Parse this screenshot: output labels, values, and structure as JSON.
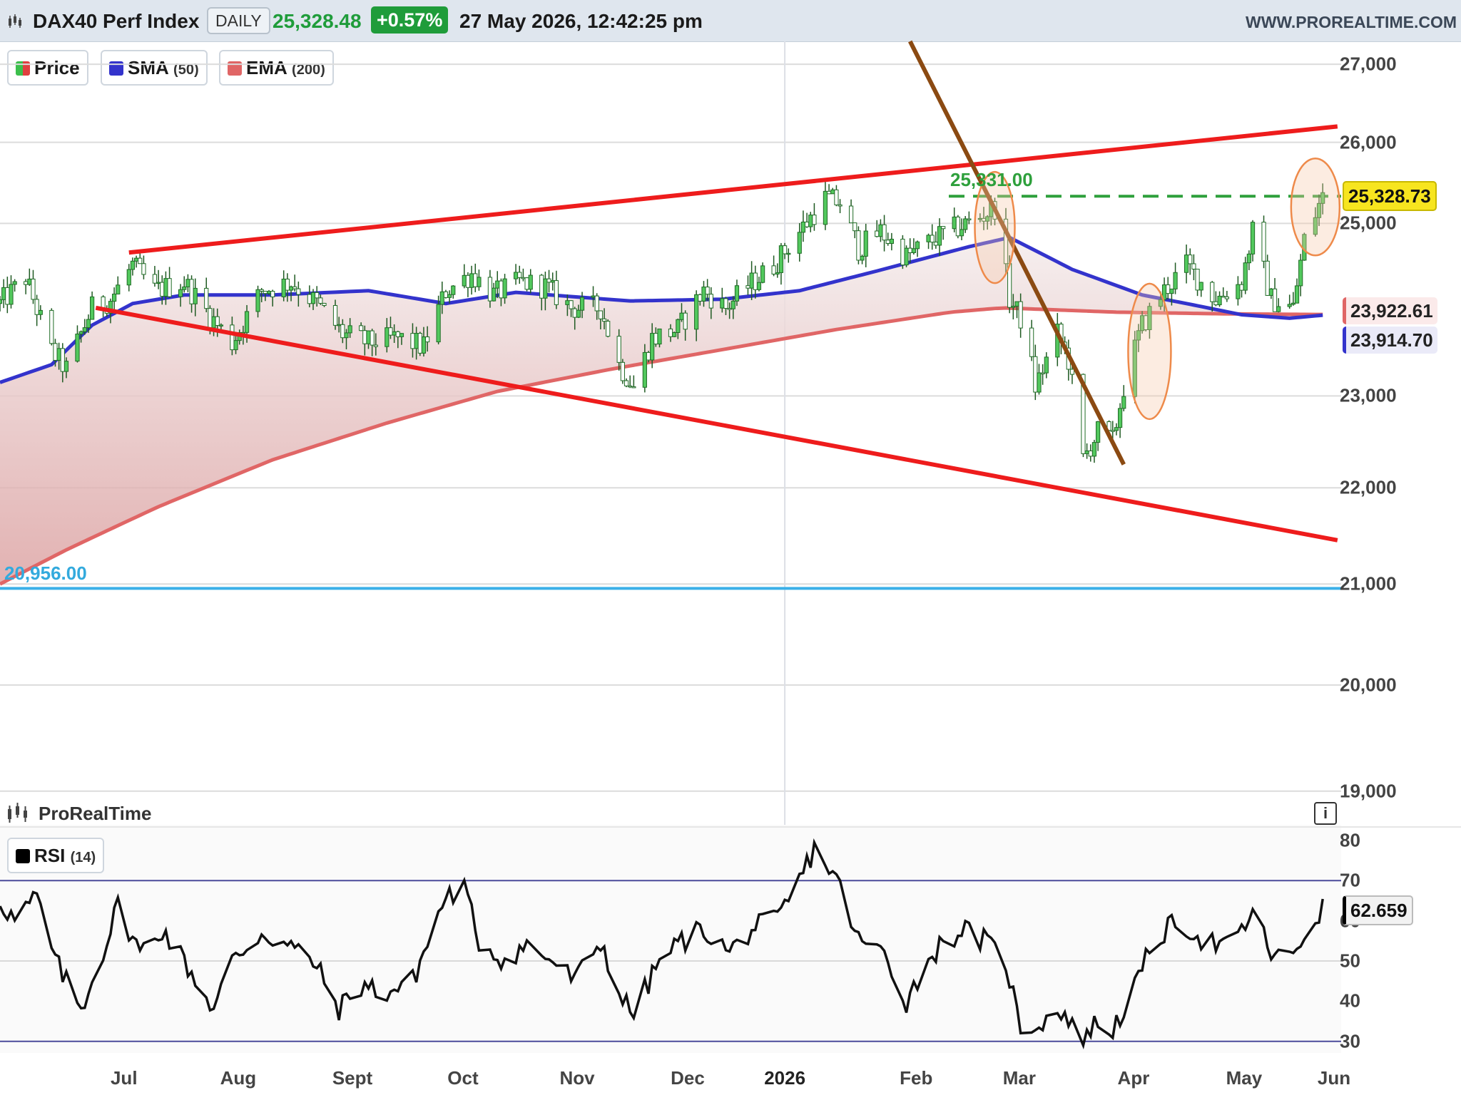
{
  "header": {
    "symbol": "DAX40 Perf Index",
    "period": "DAILY",
    "price": "25,328.48",
    "change": "+0.57%",
    "datetime": "27 May 2026, 12:42:25 pm",
    "site": "WWW.PROREALTIME.COM"
  },
  "legend": {
    "price": {
      "label": "Price",
      "color": "#3cbf4c"
    },
    "sma": {
      "label": "SMA",
      "param": "(50)",
      "color": "#3333cc"
    },
    "ema": {
      "label": "EMA",
      "param": "(200)",
      "color": "#e06666"
    },
    "rsi": {
      "label": "RSI",
      "param": "(14)",
      "color": "#000000"
    }
  },
  "branding": {
    "panel_label": "ProRealTime",
    "info_icon": "info-icon",
    "logo": "candlestick-logo-icon"
  },
  "chart_data": [
    {
      "type": "candlestick",
      "yscale": "log",
      "ylim": [
        18900,
        27300
      ],
      "yticks": [
        19000,
        20000,
        21000,
        22000,
        23000,
        25000,
        26000,
        27000
      ],
      "ytick_labels": [
        "19,000",
        "20,000",
        "21,000",
        "22,000",
        "23,000",
        "25,000",
        "26,000",
        "27,000"
      ],
      "x_labels": [
        "Jul",
        "Aug",
        "Sept",
        "Oct",
        "Nov",
        "Dec",
        "2026",
        "Feb",
        "Mar",
        "Apr",
        "May",
        "Jun"
      ],
      "x_range": [
        "2025-06-02",
        "2026-06-01"
      ],
      "close_anchors": [
        [
          "2025-06-02",
          24050
        ],
        [
          "2025-06-09",
          24350
        ],
        [
          "2025-06-16",
          23500
        ],
        [
          "2025-06-20",
          23300
        ],
        [
          "2025-06-27",
          24000
        ],
        [
          "2025-07-02",
          24100
        ],
        [
          "2025-07-08",
          24500
        ],
        [
          "2025-07-14",
          24200
        ],
        [
          "2025-07-22",
          24300
        ],
        [
          "2025-07-31",
          23800
        ],
        [
          "2025-08-04",
          23600
        ],
        [
          "2025-08-12",
          24200
        ],
        [
          "2025-08-20",
          24300
        ],
        [
          "2025-08-27",
          24050
        ],
        [
          "2025-09-03",
          23700
        ],
        [
          "2025-09-10",
          23600
        ],
        [
          "2025-09-18",
          23650
        ],
        [
          "2025-09-25",
          23550
        ],
        [
          "2025-10-01",
          24200
        ],
        [
          "2025-10-08",
          24400
        ],
        [
          "2025-10-14",
          24150
        ],
        [
          "2025-10-21",
          24300
        ],
        [
          "2025-10-28",
          24250
        ],
        [
          "2025-11-04",
          24000
        ],
        [
          "2025-11-12",
          24000
        ],
        [
          "2025-11-17",
          23350
        ],
        [
          "2025-11-21",
          23100
        ],
        [
          "2025-11-26",
          23650
        ],
        [
          "2025-12-03",
          23750
        ],
        [
          "2025-12-10",
          24200
        ],
        [
          "2025-12-16",
          24000
        ],
        [
          "2025-12-22",
          24250
        ],
        [
          "2025-12-29",
          24500
        ],
        [
          "2026-01-05",
          24900
        ],
        [
          "2026-01-12",
          25300
        ],
        [
          "2026-01-16",
          25250
        ],
        [
          "2026-01-21",
          24700
        ],
        [
          "2026-01-27",
          24900
        ],
        [
          "2026-02-03",
          24600
        ],
        [
          "2026-02-10",
          24800
        ],
        [
          "2026-02-17",
          24950
        ],
        [
          "2026-02-24",
          25100
        ],
        [
          "2026-02-27",
          25200
        ],
        [
          "2026-03-03",
          24100
        ],
        [
          "2026-03-07",
          23800
        ],
        [
          "2026-03-10",
          23100
        ],
        [
          "2026-03-16",
          23700
        ],
        [
          "2026-03-19",
          23400
        ],
        [
          "2026-03-23",
          22300
        ],
        [
          "2026-03-27",
          22600
        ],
        [
          "2026-03-31",
          22500
        ],
        [
          "2026-04-03",
          23100
        ],
        [
          "2026-04-08",
          23800
        ],
        [
          "2026-04-14",
          24200
        ],
        [
          "2026-04-20",
          24500
        ],
        [
          "2026-04-28",
          24100
        ],
        [
          "2026-05-05",
          24300
        ],
        [
          "2026-05-08",
          24900
        ],
        [
          "2026-05-13",
          24100
        ],
        [
          "2026-05-19",
          24000
        ],
        [
          "2026-05-22",
          24800
        ],
        [
          "2026-05-27",
          25328
        ]
      ],
      "sma_50": [
        [
          "2025-06-02",
          23150
        ],
        [
          "2025-06-16",
          23350
        ],
        [
          "2025-06-27",
          23800
        ],
        [
          "2025-07-08",
          24050
        ],
        [
          "2025-07-22",
          24150
        ],
        [
          "2025-08-15",
          24150
        ],
        [
          "2025-09-10",
          24200
        ],
        [
          "2025-10-01",
          24050
        ],
        [
          "2025-10-20",
          24180
        ],
        [
          "2025-11-20",
          24080
        ],
        [
          "2025-12-15",
          24100
        ],
        [
          "2026-01-05",
          24200
        ],
        [
          "2026-01-25",
          24420
        ],
        [
          "2026-02-20",
          24720
        ],
        [
          "2026-03-03",
          24830
        ],
        [
          "2026-03-20",
          24450
        ],
        [
          "2026-04-08",
          24150
        ],
        [
          "2026-04-20",
          24050
        ],
        [
          "2026-05-05",
          23920
        ],
        [
          "2026-05-18",
          23880
        ],
        [
          "2026-05-27",
          23915
        ]
      ],
      "ema_200": [
        [
          "2025-06-02",
          21000
        ],
        [
          "2025-06-20",
          21350
        ],
        [
          "2025-07-15",
          21800
        ],
        [
          "2025-08-15",
          22300
        ],
        [
          "2025-09-15",
          22700
        ],
        [
          "2025-10-15",
          23050
        ],
        [
          "2025-11-15",
          23300
        ],
        [
          "2025-12-15",
          23520
        ],
        [
          "2026-01-15",
          23750
        ],
        [
          "2026-02-15",
          23950
        ],
        [
          "2026-03-01",
          24000
        ],
        [
          "2026-04-01",
          23950
        ],
        [
          "2026-05-01",
          23930
        ],
        [
          "2026-05-27",
          23923
        ]
      ],
      "last_price": 25328.73,
      "last_price_label": "25,328.73",
      "sma_value": 23914.7,
      "sma_label": "23,914.70",
      "ema_value": 23922.61,
      "ema_label": "23,922.61",
      "support_level": 20956.0,
      "support_label": "20,956.00",
      "resistance_level": 25331.0,
      "resistance_label": "25,331.00",
      "trend_lines": {
        "upper_red": [
          [
            "2025-07-07",
            24650
          ],
          [
            "2026-05-31",
            26200
          ]
        ],
        "lower_red": [
          [
            "2025-06-28",
            24000
          ],
          [
            "2026-05-31",
            21450
          ]
        ],
        "brown": [
          [
            "2026-02-04",
            27300
          ],
          [
            "2026-04-03",
            22250
          ]
        ]
      },
      "ellipses": [
        {
          "date": "2026-02-27",
          "price": 24950
        },
        {
          "date": "2026-04-10",
          "price": 23500
        },
        {
          "date": "2026-05-25",
          "price": 25200
        }
      ]
    },
    {
      "type": "line",
      "name": "RSI (14)",
      "ylim": [
        28,
        83
      ],
      "yticks": [
        30,
        40,
        50,
        60,
        70,
        80
      ],
      "ytick_labels": [
        "30",
        "40",
        "50",
        "60",
        "70",
        "80"
      ],
      "levels": [
        30,
        70
      ],
      "last_value": 62.659,
      "last_label": "62.659",
      "anchors": [
        [
          "2025-06-02",
          65
        ],
        [
          "2025-06-06",
          60
        ],
        [
          "2025-06-12",
          66
        ],
        [
          "2025-06-17",
          50
        ],
        [
          "2025-06-24",
          38
        ],
        [
          "2025-07-01",
          55
        ],
        [
          "2025-07-04",
          64
        ],
        [
          "2025-07-10",
          52
        ],
        [
          "2025-07-16",
          58
        ],
        [
          "2025-07-22",
          50
        ],
        [
          "2025-07-30",
          38
        ],
        [
          "2025-08-04",
          50
        ],
        [
          "2025-08-12",
          57
        ],
        [
          "2025-08-19",
          54
        ],
        [
          "2025-08-26",
          50
        ],
        [
          "2025-09-02",
          38
        ],
        [
          "2025-09-08",
          44
        ],
        [
          "2025-09-15",
          42
        ],
        [
          "2025-09-22",
          45
        ],
        [
          "2025-10-01",
          66
        ],
        [
          "2025-10-06",
          68
        ],
        [
          "2025-10-10",
          55
        ],
        [
          "2025-10-17",
          50
        ],
        [
          "2025-10-23",
          54
        ],
        [
          "2025-10-30",
          50
        ],
        [
          "2025-11-05",
          45
        ],
        [
          "2025-11-12",
          55
        ],
        [
          "2025-11-18",
          40
        ],
        [
          "2025-11-21",
          37
        ],
        [
          "2025-11-28",
          50
        ],
        [
          "2025-12-04",
          55
        ],
        [
          "2025-12-10",
          58
        ],
        [
          "2025-12-17",
          52
        ],
        [
          "2025-12-23",
          58
        ],
        [
          "2025-12-30",
          60
        ],
        [
          "2026-01-05",
          70
        ],
        [
          "2026-01-09",
          78
        ],
        [
          "2026-01-14",
          72
        ],
        [
          "2026-01-17",
          66
        ],
        [
          "2026-01-21",
          55
        ],
        [
          "2026-01-28",
          52
        ],
        [
          "2026-02-03",
          40
        ],
        [
          "2026-02-10",
          52
        ],
        [
          "2026-02-18",
          58
        ],
        [
          "2026-02-24",
          55
        ],
        [
          "2026-03-02",
          50
        ],
        [
          "2026-03-06",
          33
        ],
        [
          "2026-03-12",
          35
        ],
        [
          "2026-03-17",
          38
        ],
        [
          "2026-03-22",
          30
        ],
        [
          "2026-03-26",
          34
        ],
        [
          "2026-03-31",
          33
        ],
        [
          "2026-04-07",
          45
        ],
        [
          "2026-04-11",
          55
        ],
        [
          "2026-04-18",
          60
        ],
        [
          "2026-04-25",
          55
        ],
        [
          "2026-05-02",
          53
        ],
        [
          "2026-05-08",
          62
        ],
        [
          "2026-05-13",
          52
        ],
        [
          "2026-05-18",
          50
        ],
        [
          "2026-05-23",
          58
        ],
        [
          "2026-05-27",
          63
        ]
      ]
    }
  ]
}
